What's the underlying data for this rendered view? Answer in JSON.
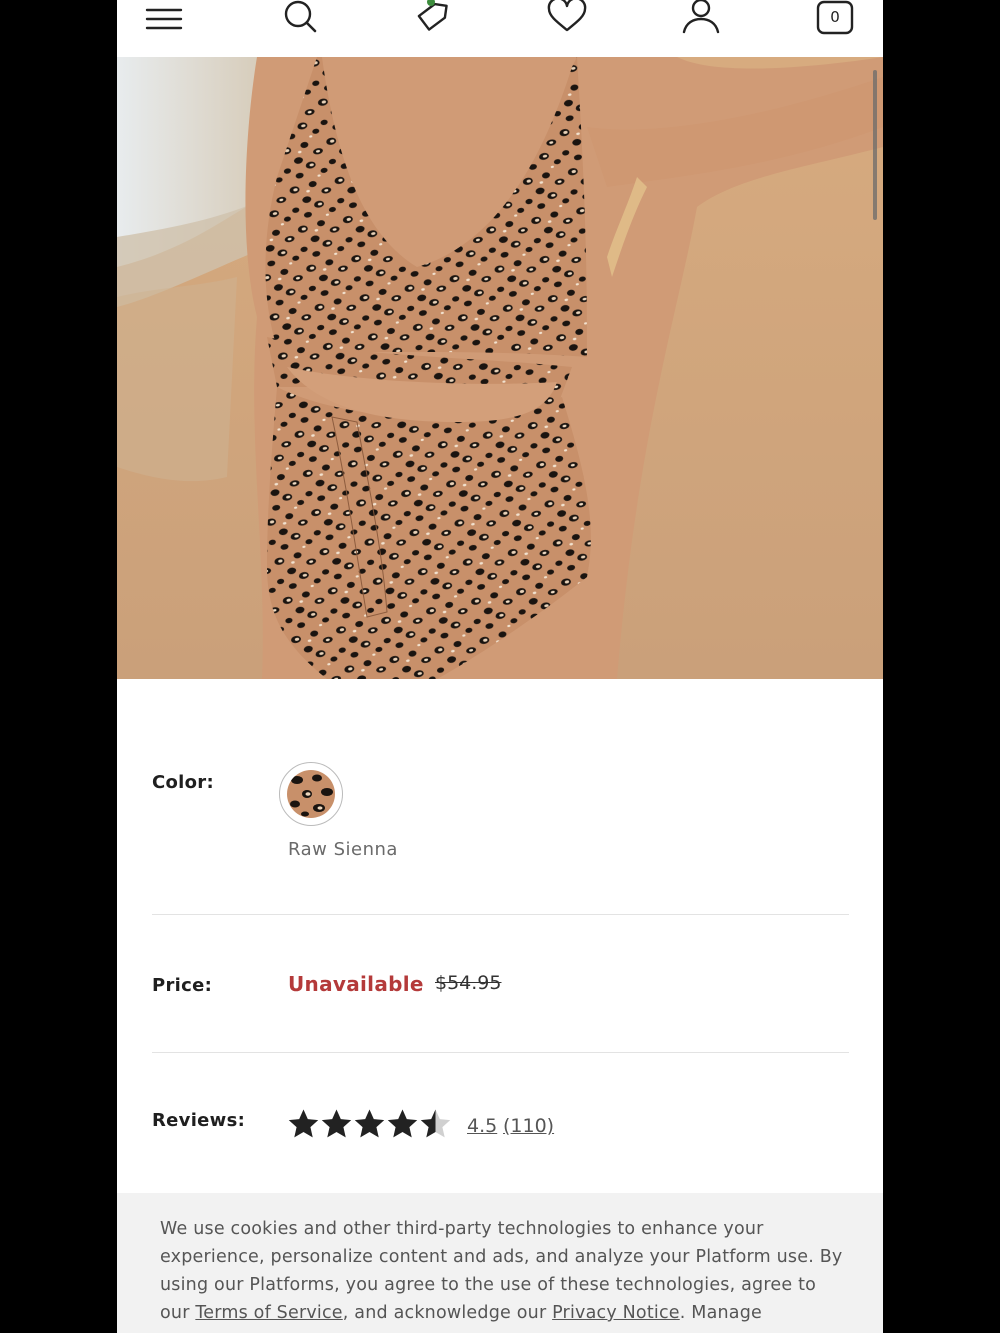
{
  "nav": {
    "menu_icon": "hamburger-icon",
    "search_icon": "search-icon",
    "deals_icon": "tag-icon",
    "wishlist_icon": "heart-icon",
    "account_icon": "user-icon",
    "bag_icon": "shopping-bag-icon",
    "bag_count": "0"
  },
  "gallery": {
    "image_count": 5,
    "active_index": 0
  },
  "product": {
    "color_label": "Color:",
    "color_name": "Raw Sienna",
    "price_label": "Price:",
    "price_status": "Unavailable",
    "original_price": "$54.95",
    "reviews_label": "Reviews:",
    "rating": "4.5",
    "rating_value": 4.5,
    "review_count": "(110)"
  },
  "cookie_banner": {
    "text_1": "We use cookies and other third-party technologies to enhance your experience, personalize content and ads, and analyze your Platform use. By using our Platforms, you agree to the use of these technologies, agree to our ",
    "terms_link": "Terms of Service",
    "text_2": ", and acknowledge our ",
    "privacy_link": "Privacy Notice",
    "text_3": ". Manage"
  },
  "colors": {
    "unavailable_red": "#b43a3a",
    "active_dot_green": "#5a8a52",
    "swimsuit_tan": "#c8906a"
  }
}
